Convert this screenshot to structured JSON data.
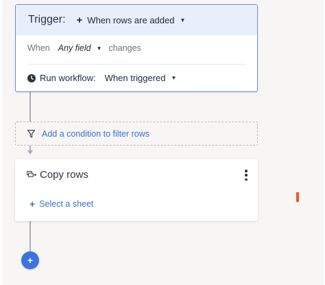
{
  "trigger": {
    "label": "Trigger:",
    "event_option": "When rows are added",
    "event_icon": "plus-icon",
    "condition": {
      "prefix": "When",
      "field_option": "Any field",
      "suffix": "changes"
    },
    "run_workflow": {
      "label": "Run workflow:",
      "option": "When triggered",
      "icon": "clock-icon"
    }
  },
  "condition_filter": {
    "link_text": "Add a condition to filter rows",
    "icon": "filter-icon"
  },
  "action": {
    "title": "Copy rows",
    "icon": "copy-rows-icon",
    "select_sheet_text": "Select a sheet",
    "menu_icon": "more-vertical-icon"
  },
  "add_step": {
    "glyph": "+"
  },
  "colors": {
    "accent": "#3d73e0",
    "link": "#3b6fd1",
    "trigger_header_bg": "#e8eefb",
    "trigger_border": "#6a8edb",
    "marker": "#f0561e"
  }
}
